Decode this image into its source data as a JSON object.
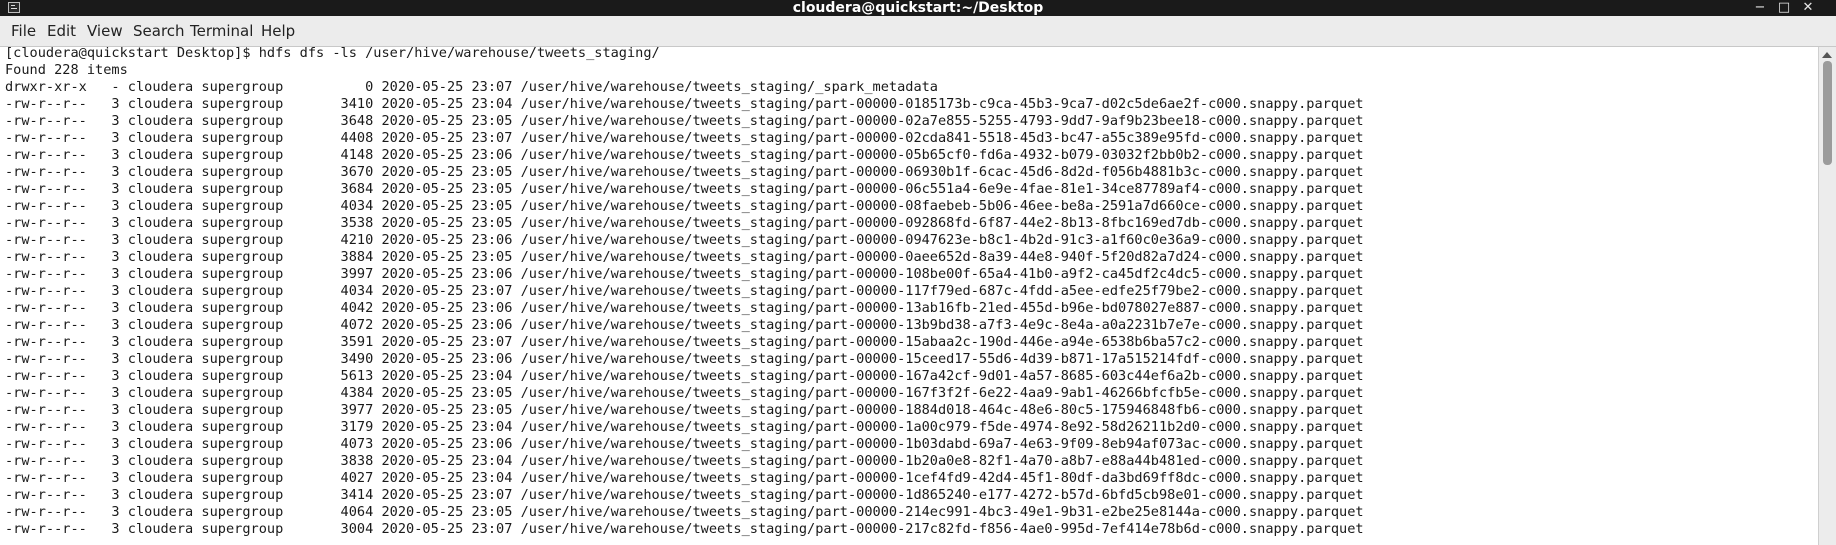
{
  "window": {
    "title": "cloudera@quickstart:~/Desktop",
    "controls": {
      "minimize": "−",
      "maximize": "□",
      "close": "✕"
    }
  },
  "menu": [
    "File",
    "Edit",
    "View",
    "Search",
    "Terminal",
    "Help"
  ],
  "terminal": {
    "lines": [
      "[cloudera@quickstart Desktop]$ hdfs dfs -ls /user/hive/warehouse/tweets_staging/",
      "Found 228 items",
      "drwxr-xr-x   - cloudera supergroup          0 2020-05-25 23:07 /user/hive/warehouse/tweets_staging/_spark_metadata",
      "-rw-r--r--   3 cloudera supergroup       3410 2020-05-25 23:04 /user/hive/warehouse/tweets_staging/part-00000-0185173b-c9ca-45b3-9ca7-d02c5de6ae2f-c000.snappy.parquet",
      "-rw-r--r--   3 cloudera supergroup       3648 2020-05-25 23:05 /user/hive/warehouse/tweets_staging/part-00000-02a7e855-5255-4793-9dd7-9af9b23bee18-c000.snappy.parquet",
      "-rw-r--r--   3 cloudera supergroup       4408 2020-05-25 23:07 /user/hive/warehouse/tweets_staging/part-00000-02cda841-5518-45d3-bc47-a55c389e95fd-c000.snappy.parquet",
      "-rw-r--r--   3 cloudera supergroup       4148 2020-05-25 23:06 /user/hive/warehouse/tweets_staging/part-00000-05b65cf0-fd6a-4932-b079-03032f2bb0b2-c000.snappy.parquet",
      "-rw-r--r--   3 cloudera supergroup       3670 2020-05-25 23:05 /user/hive/warehouse/tweets_staging/part-00000-06930b1f-6cac-45d6-8d2d-f056b4881b3c-c000.snappy.parquet",
      "-rw-r--r--   3 cloudera supergroup       3684 2020-05-25 23:05 /user/hive/warehouse/tweets_staging/part-00000-06c551a4-6e9e-4fae-81e1-34ce87789af4-c000.snappy.parquet",
      "-rw-r--r--   3 cloudera supergroup       4034 2020-05-25 23:05 /user/hive/warehouse/tweets_staging/part-00000-08faebeb-5b06-46ee-be8a-2591a7d660ce-c000.snappy.parquet",
      "-rw-r--r--   3 cloudera supergroup       3538 2020-05-25 23:05 /user/hive/warehouse/tweets_staging/part-00000-092868fd-6f87-44e2-8b13-8fbc169ed7db-c000.snappy.parquet",
      "-rw-r--r--   3 cloudera supergroup       4210 2020-05-25 23:06 /user/hive/warehouse/tweets_staging/part-00000-0947623e-b8c1-4b2d-91c3-a1f60c0e36a9-c000.snappy.parquet",
      "-rw-r--r--   3 cloudera supergroup       3884 2020-05-25 23:05 /user/hive/warehouse/tweets_staging/part-00000-0aee652d-8a39-44e8-940f-5f20d82a7d24-c000.snappy.parquet",
      "-rw-r--r--   3 cloudera supergroup       3997 2020-05-25 23:06 /user/hive/warehouse/tweets_staging/part-00000-108be00f-65a4-41b0-a9f2-ca45df2c4dc5-c000.snappy.parquet",
      "-rw-r--r--   3 cloudera supergroup       4034 2020-05-25 23:07 /user/hive/warehouse/tweets_staging/part-00000-117f79ed-687c-4fdd-a5ee-edfe25f79be2-c000.snappy.parquet",
      "-rw-r--r--   3 cloudera supergroup       4042 2020-05-25 23:06 /user/hive/warehouse/tweets_staging/part-00000-13ab16fb-21ed-455d-b96e-bd078027e887-c000.snappy.parquet",
      "-rw-r--r--   3 cloudera supergroup       4072 2020-05-25 23:06 /user/hive/warehouse/tweets_staging/part-00000-13b9bd38-a7f3-4e9c-8e4a-a0a2231b7e7e-c000.snappy.parquet",
      "-rw-r--r--   3 cloudera supergroup       3591 2020-05-25 23:07 /user/hive/warehouse/tweets_staging/part-00000-15abaa2c-190d-446e-a94e-6538b6ba57c2-c000.snappy.parquet",
      "-rw-r--r--   3 cloudera supergroup       3490 2020-05-25 23:06 /user/hive/warehouse/tweets_staging/part-00000-15ceed17-55d6-4d39-b871-17a515214fdf-c000.snappy.parquet",
      "-rw-r--r--   3 cloudera supergroup       5613 2020-05-25 23:04 /user/hive/warehouse/tweets_staging/part-00000-167a42cf-9d01-4a57-8685-603c44ef6a2b-c000.snappy.parquet",
      "-rw-r--r--   3 cloudera supergroup       4384 2020-05-25 23:05 /user/hive/warehouse/tweets_staging/part-00000-167f3f2f-6e22-4aa9-9ab1-46266bfcfb5e-c000.snappy.parquet",
      "-rw-r--r--   3 cloudera supergroup       3977 2020-05-25 23:05 /user/hive/warehouse/tweets_staging/part-00000-1884d018-464c-48e6-80c5-175946848fb6-c000.snappy.parquet",
      "-rw-r--r--   3 cloudera supergroup       3179 2020-05-25 23:04 /user/hive/warehouse/tweets_staging/part-00000-1a00c979-f5de-4974-8e92-58d26211b2d0-c000.snappy.parquet",
      "-rw-r--r--   3 cloudera supergroup       4073 2020-05-25 23:06 /user/hive/warehouse/tweets_staging/part-00000-1b03dabd-69a7-4e63-9f09-8eb94af073ac-c000.snappy.parquet",
      "-rw-r--r--   3 cloudera supergroup       3838 2020-05-25 23:04 /user/hive/warehouse/tweets_staging/part-00000-1b20a0e8-82f1-4a70-a8b7-e88a44b481ed-c000.snappy.parquet",
      "-rw-r--r--   3 cloudera supergroup       4027 2020-05-25 23:04 /user/hive/warehouse/tweets_staging/part-00000-1cef4fd9-42d4-45f1-80df-da3bd69ff8dc-c000.snappy.parquet",
      "-rw-r--r--   3 cloudera supergroup       3414 2020-05-25 23:07 /user/hive/warehouse/tweets_staging/part-00000-1d865240-e177-4272-b57d-6bfd5cb98e01-c000.snappy.parquet",
      "-rw-r--r--   3 cloudera supergroup       4064 2020-05-25 23:05 /user/hive/warehouse/tweets_staging/part-00000-214ec991-4bc3-49e1-9b31-e2be25e8144a-c000.snappy.parquet",
      "-rw-r--r--   3 cloudera supergroup       3004 2020-05-25 23:07 /user/hive/warehouse/tweets_staging/part-00000-217c82fd-f856-4ae0-995d-7ef414e78b6d-c000.snappy.parquet"
    ]
  }
}
